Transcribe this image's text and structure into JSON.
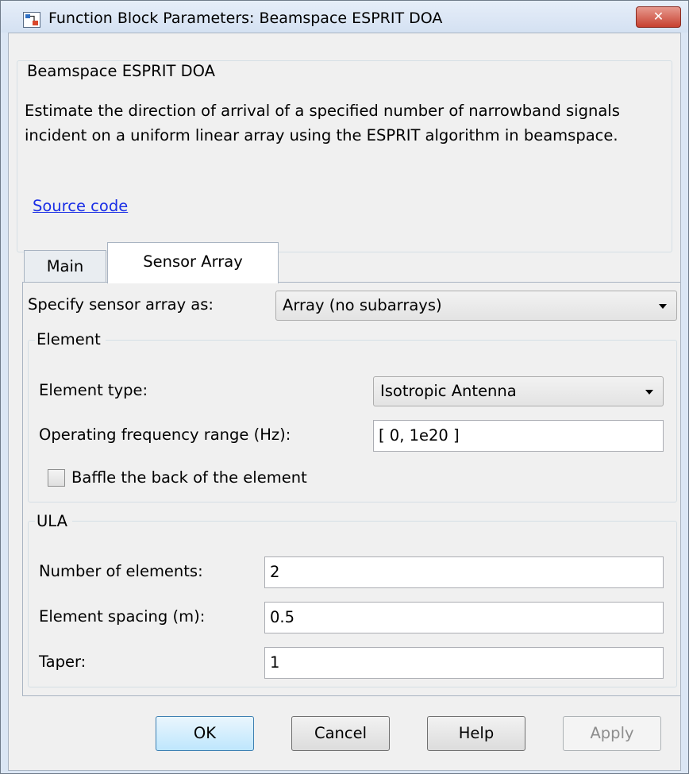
{
  "window": {
    "title": "Function Block Parameters: Beamspace ESPRIT DOA",
    "close_glyph": "✕"
  },
  "description": {
    "group_title": "Beamspace ESPRIT DOA",
    "text": "Estimate the direction of arrival of a specified number of narrowband signals incident on a uniform linear array using the ESPRIT algorithm in beamspace.",
    "source_link": "Source code"
  },
  "tabs": [
    {
      "label": "Main",
      "selected": false
    },
    {
      "label": "Sensor Array",
      "selected": true
    }
  ],
  "sensor_array": {
    "specify_label": "Specify sensor array as:",
    "specify_value": "Array (no subarrays)",
    "element_group": {
      "title": "Element",
      "type_label": "Element type:",
      "type_value": "Isotropic Antenna",
      "freq_label": "Operating frequency range (Hz):",
      "freq_value": "[ 0, 1e20 ]",
      "baffle_label": "Baffle the back of the element",
      "baffle_checked": false
    },
    "ula_group": {
      "title": "ULA",
      "num_elements_label": "Number of elements:",
      "num_elements_value": "2",
      "spacing_label": "Element spacing (m):",
      "spacing_value": "0.5",
      "taper_label": "Taper:",
      "taper_value": "1"
    }
  },
  "buttons": {
    "ok": "OK",
    "cancel": "Cancel",
    "help": "Help",
    "apply": "Apply"
  }
}
